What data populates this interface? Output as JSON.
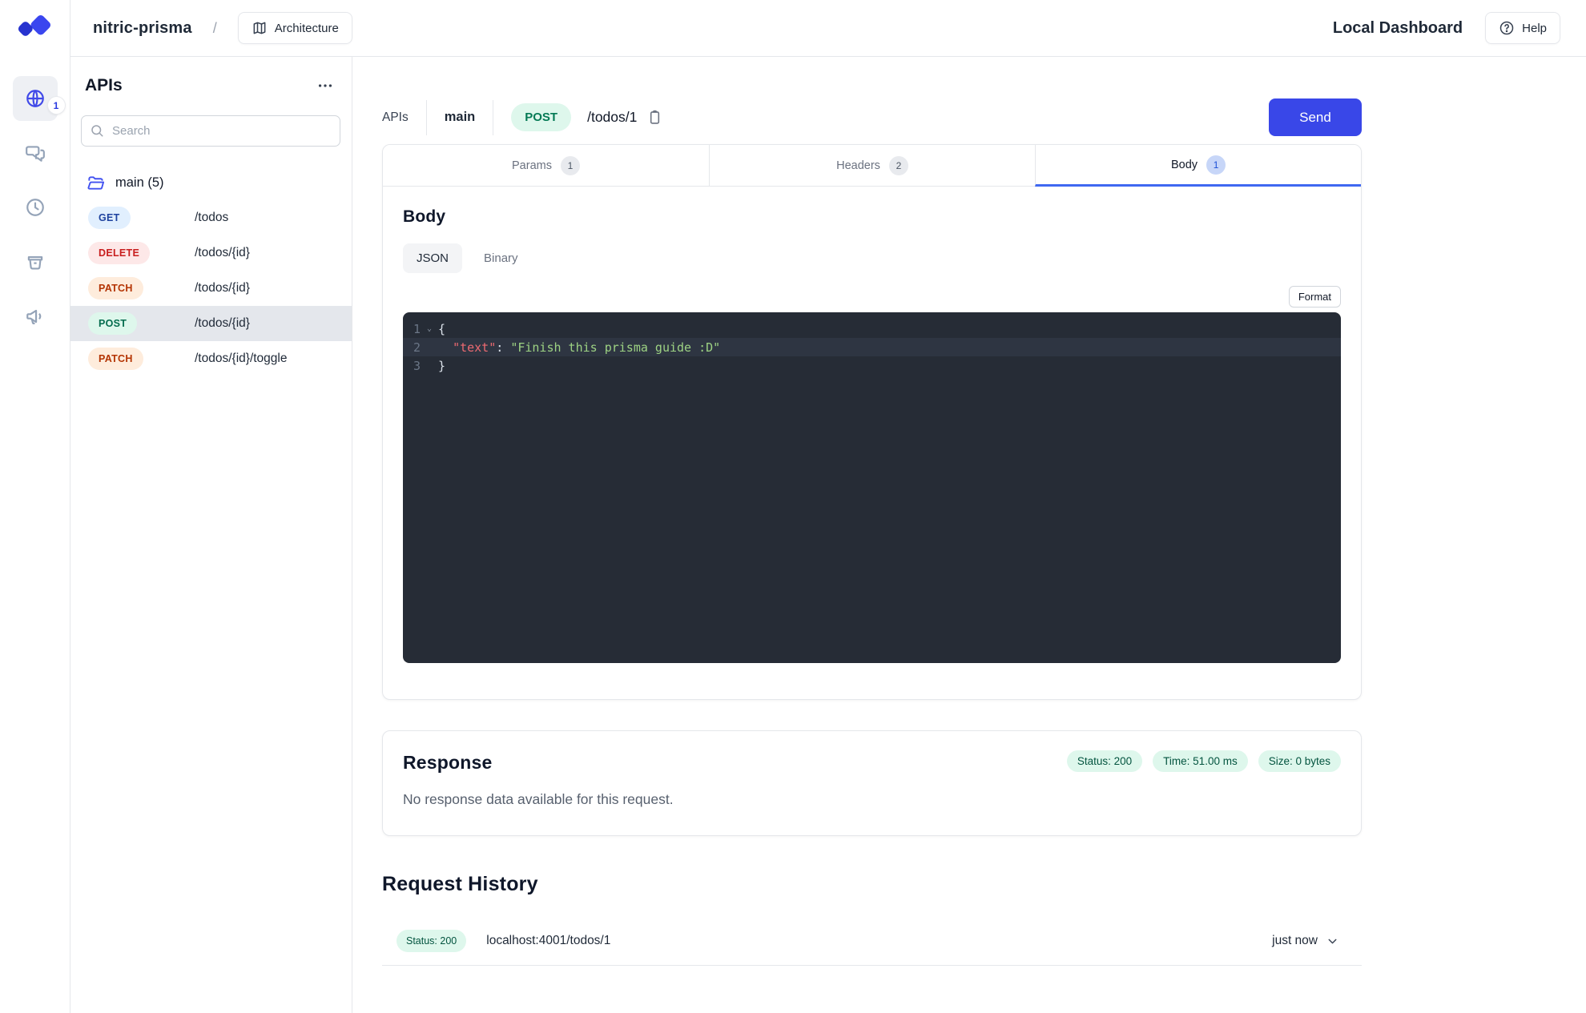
{
  "topbar": {
    "project_name": "nitric-prisma",
    "separator": "/",
    "architecture_label": "Architecture",
    "dashboard_label": "Local Dashboard",
    "help_label": "Help"
  },
  "rail": {
    "apis_badge": "1"
  },
  "sidebar": {
    "title": "APIs",
    "search_placeholder": "Search",
    "group_label": "main (5)",
    "endpoints": [
      {
        "method": "GET",
        "path": "/todos"
      },
      {
        "method": "DELETE",
        "path": "/todos/{id}"
      },
      {
        "method": "PATCH",
        "path": "/todos/{id}"
      },
      {
        "method": "POST",
        "path": "/todos/{id}"
      },
      {
        "method": "PATCH",
        "path": "/todos/{id}/toggle"
      }
    ]
  },
  "request": {
    "breadcrumb": {
      "root": "APIs",
      "api": "main",
      "method": "POST",
      "path": "/todos/1"
    },
    "send_label": "Send",
    "tabs": [
      {
        "label": "Params",
        "count": "1"
      },
      {
        "label": "Headers",
        "count": "2"
      },
      {
        "label": "Body",
        "count": "1"
      }
    ],
    "body": {
      "heading": "Body",
      "mode_json": "JSON",
      "mode_binary": "Binary",
      "format_label": "Format",
      "editor_lines": [
        {
          "num": "1",
          "tokens": [
            {
              "text": "{",
              "type": "punct"
            }
          ]
        },
        {
          "num": "2",
          "tokens": [
            {
              "text": "  ",
              "type": "punct"
            },
            {
              "text": "\"text\"",
              "type": "key"
            },
            {
              "text": ": ",
              "type": "punct"
            },
            {
              "text": "\"Finish this prisma guide :D\"",
              "type": "string"
            }
          ]
        },
        {
          "num": "3",
          "tokens": [
            {
              "text": "}",
              "type": "punct"
            }
          ]
        }
      ]
    }
  },
  "response": {
    "heading": "Response",
    "badges": [
      "Status: 200",
      "Time: 51.00 ms",
      "Size: 0 bytes"
    ],
    "empty_message": "No response data available for this request."
  },
  "history": {
    "heading": "Request History",
    "rows": [
      {
        "status": "Status: 200",
        "url": "localhost:4001/todos/1",
        "time": "just now"
      }
    ]
  },
  "colors": {
    "accent_blue": "#3947e8",
    "tab_underline": "#3f68f1",
    "method_get": "#1e429f",
    "method_delete": "#c81e1e",
    "method_patch": "#b43403",
    "method_post": "#046c4e",
    "status_green_bg": "#def7ec",
    "status_green_text": "#03543f",
    "editor_bg": "#262c36",
    "editor_key": "#ed6a71",
    "editor_string": "#9dd283"
  }
}
